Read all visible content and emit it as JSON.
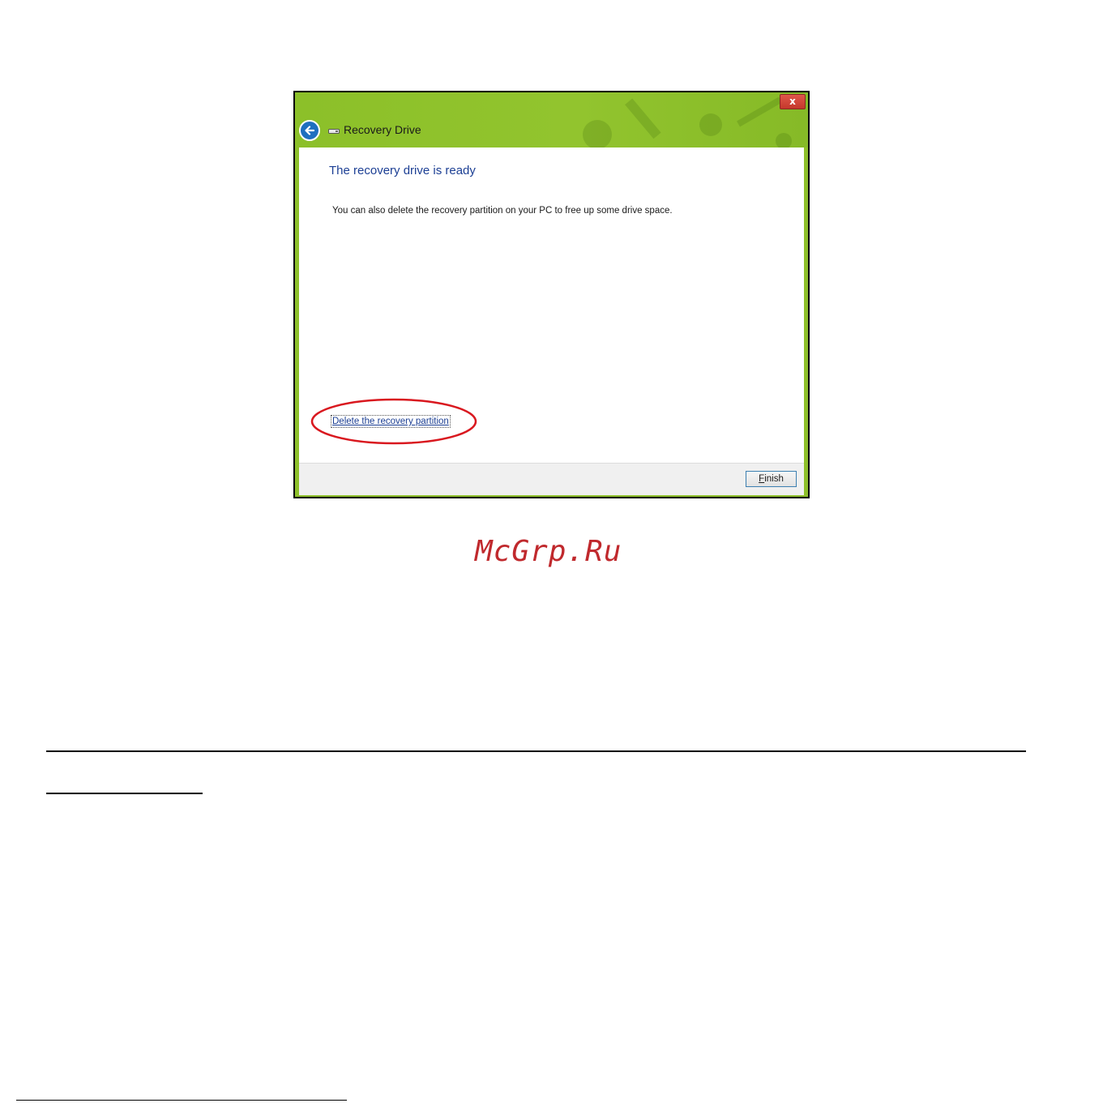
{
  "dialog": {
    "title": "Recovery Drive",
    "close_label": "x",
    "heading": "The recovery drive is ready",
    "body": "You can also delete the recovery partition on your PC to free up some drive space.",
    "delete_link": "Delete the recovery partition",
    "finish_button": {
      "mnemonic": "F",
      "rest": "inish"
    }
  },
  "page": {
    "watermark": "McGrp.Ru"
  },
  "colors": {
    "titlebar_green": "#8dbf2a",
    "heading_blue": "#1c3f94",
    "annotation_red": "#d9181f",
    "watermark_red": "#c0292d"
  }
}
